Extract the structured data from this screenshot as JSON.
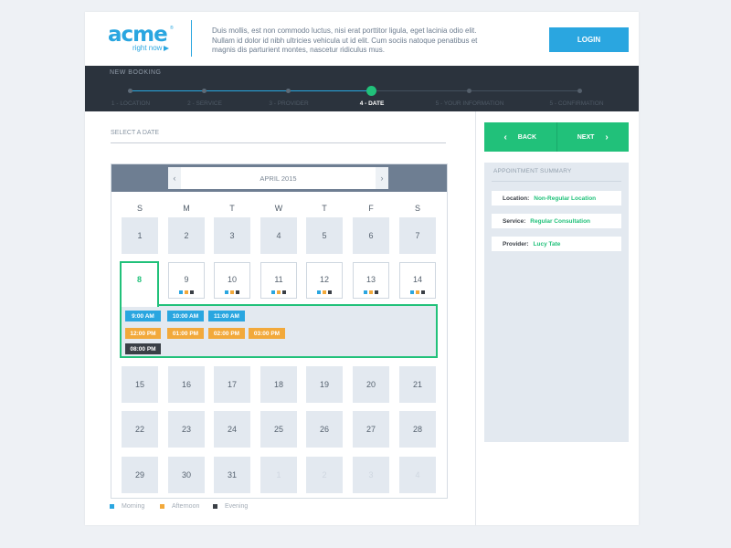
{
  "header": {
    "logo_word": "acme",
    "logo_tagline": "right now",
    "logo_reg": "®",
    "blurb": "Duis mollis, est non commodo luctus, nisi erat porttitor ligula, eget lacinia odio  elit. Nullam id dolor id nibh ultricies vehicula ut id elit. Cum sociis natoque penatibus et magnis dis parturient montes, nascetur ridiculus mus.",
    "login_label": "LOGIN"
  },
  "booking": {
    "title": "NEW BOOKING",
    "steps": [
      {
        "label": "1 - LOCATION",
        "state": "done"
      },
      {
        "label": "2 - SERVICE",
        "state": "done"
      },
      {
        "label": "3 - PROVIDER",
        "state": "done"
      },
      {
        "label": "4 - DATE",
        "state": "active"
      },
      {
        "label": "5 - YOUR INFORMATION",
        "state": "pending"
      },
      {
        "label": "5 - CONFIRMATION",
        "state": "pending"
      }
    ]
  },
  "date_section": {
    "title": "SELECT A DATE"
  },
  "calendar": {
    "month_label": "APRIL 2015",
    "prev_icon": "‹",
    "next_icon": "›",
    "weekdays": [
      "S",
      "M",
      "T",
      "W",
      "T",
      "F",
      "S"
    ],
    "week1": [
      "1",
      "2",
      "3",
      "4",
      "5",
      "6",
      "7"
    ],
    "selected_day": "8",
    "week2_available": [
      "9",
      "10",
      "11",
      "12",
      "13",
      "14"
    ],
    "week3": [
      "15",
      "16",
      "17",
      "18",
      "19",
      "20",
      "21"
    ],
    "week4": [
      "22",
      "23",
      "24",
      "25",
      "26",
      "27",
      "28"
    ],
    "week5": [
      "29",
      "30",
      "31",
      "1",
      "2",
      "3",
      "4"
    ],
    "slots": {
      "morning": [
        "9:00 AM",
        "10:00 AM",
        "11:00 AM"
      ],
      "afternoon": [
        "12:00 PM",
        "01:00 PM",
        "02:00 PM",
        "03:00 PM"
      ],
      "evening": [
        "08:00 PM"
      ]
    },
    "legend": {
      "morning": "Morning",
      "afternoon": "Afternoon",
      "evening": "Evening"
    },
    "colors": {
      "morning": "#2aa6e0",
      "afternoon": "#f2a93b",
      "evening": "#3a3f46",
      "selected": "#21c17a"
    }
  },
  "nav": {
    "back_label": "BACK",
    "next_label": "NEXT",
    "back_icon": "chevron-left-icon",
    "next_icon": "chevron-right-icon"
  },
  "summary": {
    "title": "APPOINTMENT SUMMARY",
    "location_label": "Location:",
    "location_value": "Non-Regular Location",
    "service_label": "Service:",
    "service_value": "Regular Consultation",
    "provider_label": "Provider:",
    "provider_value": "Lucy Tate"
  }
}
